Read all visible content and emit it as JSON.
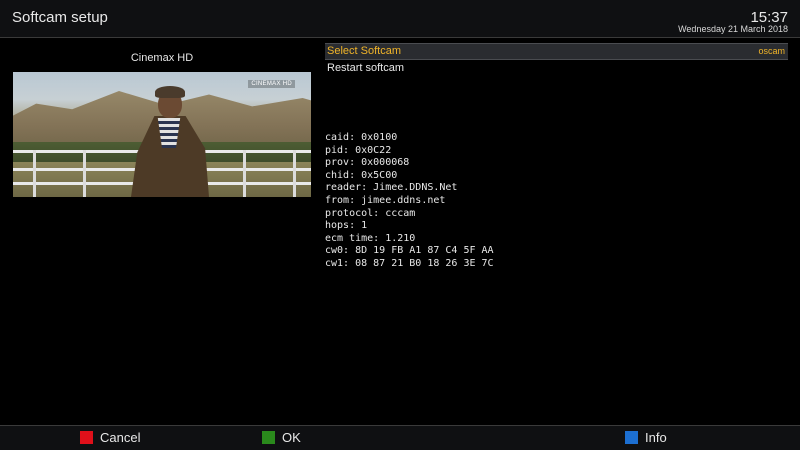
{
  "header": {
    "title": "Softcam setup",
    "time": "15:37",
    "date": "Wednesday 21 March 2018"
  },
  "preview": {
    "channel": "Cinemax HD",
    "watermark": "CINEMAX HD"
  },
  "menu": {
    "items": [
      {
        "label": "Select Softcam",
        "value": "oscam",
        "selected": true
      },
      {
        "label": "Restart softcam",
        "value": "",
        "selected": false
      }
    ]
  },
  "info": {
    "lines": [
      "caid: 0x0100",
      "pid: 0x0C22",
      "prov: 0x000068",
      "chid: 0x5C00",
      "reader: Jimee.DDNS.Net",
      "from: jimee.ddns.net",
      "protocol: cccam",
      "hops: 1",
      "ecm time: 1.210",
      "cw0: 8D 19 FB A1 87 C4 5F AA",
      "cw1: 08 87 21 B0 18 26 3E 7C"
    ]
  },
  "footer": {
    "cancel_label": "Cancel",
    "ok_label": "OK",
    "info_label": "Info"
  },
  "colors": {
    "accent": "#f0b429",
    "red_key": "#e0101a",
    "green_key": "#2a8a1c",
    "blue_key": "#1c6fd1"
  }
}
